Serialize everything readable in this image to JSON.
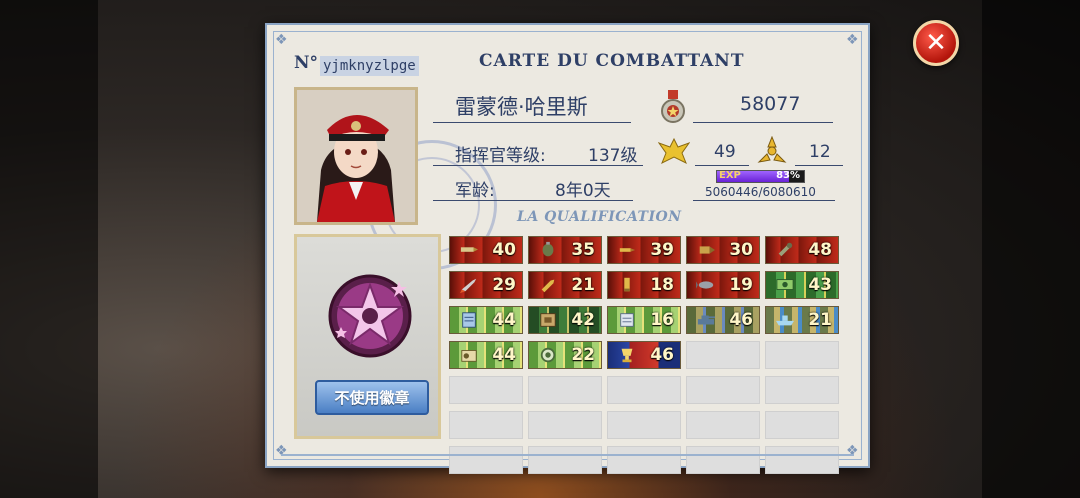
{
  "card": {
    "title": "CARTE DU COMBATTANT",
    "number_label": "N°",
    "player_id": "yjmknyzlpge",
    "qualification_label": "LA QUALIFICATION"
  },
  "profile": {
    "name": "雷蒙德·哈里斯",
    "medal_score": "58077",
    "level_label": "指挥官等级:",
    "level_value": "137级",
    "rank_stat": "49",
    "special_stat": "12",
    "service_label": "军龄:",
    "service_value": "8年0天",
    "exp_label": "EXP",
    "exp_percent": "83%",
    "exp_fraction": 0.83,
    "exp_text": "5060446/6080610"
  },
  "badge": {
    "button_label": "不使用徽章"
  },
  "qualifications": [
    {
      "value": "40",
      "style": "red",
      "icon": "bullet-icon"
    },
    {
      "value": "35",
      "style": "red",
      "icon": "grenade-icon"
    },
    {
      "value": "39",
      "style": "red",
      "icon": "rifle-round-icon"
    },
    {
      "value": "30",
      "style": "red",
      "icon": "shell-icon"
    },
    {
      "value": "48",
      "style": "red",
      "icon": "mortar-icon"
    },
    {
      "value": "29",
      "style": "red",
      "icon": "rocket-icon"
    },
    {
      "value": "21",
      "style": "red",
      "icon": "artillery-shell-icon"
    },
    {
      "value": "18",
      "style": "red",
      "icon": "cartridge-icon"
    },
    {
      "value": "19",
      "style": "red",
      "icon": "bomb-icon"
    },
    {
      "value": "43",
      "style": "green",
      "icon": "cash-icon"
    },
    {
      "value": "44",
      "style": "lightgreen",
      "icon": "document-icon"
    },
    {
      "value": "42",
      "style": "darkgreen",
      "icon": "map-icon"
    },
    {
      "value": "16",
      "style": "lightgreen",
      "icon": "scroll-icon"
    },
    {
      "value": "46",
      "style": "olive",
      "icon": "tank-icon"
    },
    {
      "value": "21",
      "style": "teal",
      "icon": "ship-icon"
    },
    {
      "value": "44",
      "style": "lightgreen",
      "icon": "radio-icon"
    },
    {
      "value": "22",
      "style": "lightgreen",
      "icon": "gear-icon"
    },
    {
      "value": "46",
      "style": "navy",
      "icon": "trophy-icon"
    }
  ],
  "empty_slots": 17
}
